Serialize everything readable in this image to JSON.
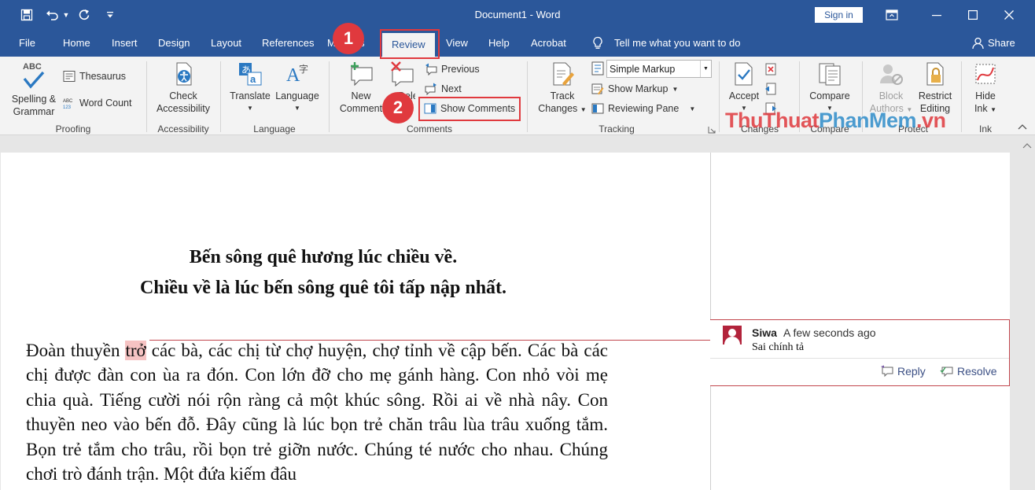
{
  "window": {
    "title": "Document1  -  Word",
    "sign_in": "Sign in",
    "quick_access": [
      "save-icon",
      "undo-icon",
      "redo-icon",
      "customize-icon"
    ],
    "controls": [
      "ribbon-display-icon",
      "minimize-icon",
      "maximize-icon",
      "close-icon"
    ]
  },
  "tabs": {
    "file": "File",
    "home": "Home",
    "insert": "Insert",
    "design": "Design",
    "layout": "Layout",
    "references": "References",
    "mailings": "Mailings",
    "review": "Review",
    "view": "View",
    "help": "Help",
    "acrobat": "Acrobat",
    "tell_me": "Tell me what you want to do",
    "share": "Share"
  },
  "ribbon": {
    "proofing": {
      "label": "Proofing",
      "spelling_line1": "Spelling &",
      "spelling_line2": "Grammar",
      "abc_caption": "ABC",
      "thesaurus": "Thesaurus",
      "word_count": "Word Count"
    },
    "accessibility": {
      "label": "Accessibility",
      "check_line1": "Check",
      "check_line2": "Accessibility"
    },
    "language": {
      "label": "Language",
      "translate": "Translate",
      "language": "Language"
    },
    "comments": {
      "label": "Comments",
      "new_line1": "New",
      "new_line2": "Comment",
      "delete": "Delete",
      "previous": "Previous",
      "next": "Next",
      "show_comments": "Show Comments"
    },
    "tracking": {
      "label": "Tracking",
      "track_line1": "Track",
      "track_line2": "Changes",
      "markup_select": "Simple Markup",
      "show_markup": "Show Markup",
      "reviewing_pane": "Reviewing Pane"
    },
    "changes": {
      "label": "Changes",
      "accept": "Accept"
    },
    "compare": {
      "label": "Compare",
      "compare": "Compare"
    },
    "protect": {
      "label": "Protect",
      "block_line1": "Block",
      "block_line2": "Authors",
      "restrict_line1": "Restrict",
      "restrict_line2": "Editing"
    },
    "ink": {
      "label": "Ink",
      "hide_line1": "Hide",
      "hide_line2": "Ink"
    }
  },
  "annotations": {
    "step1": "1",
    "step2": "2"
  },
  "watermark": {
    "part1": "ThuThuat",
    "part2": "PhanMem",
    "part3": ".vn"
  },
  "document": {
    "title_line1": "Bến sông quê hương lúc chiều về.",
    "title_line2": "Chiều về là lúc bến sông quê tôi tấp nập nhất.",
    "para_before": "Đoàn thuyền ",
    "para_marked": "trở",
    "para_after": " các bà, các chị từ chợ huyện, chợ tỉnh về cập bến. Các bà các chị được đàn con ùa ra đón. Con lớn đỡ cho mẹ gánh hàng. Con nhỏ vòi mẹ chia quà. Tiếng cười nói rộn ràng cả một khúc sông. Rồi ai về nhà nây. Con thuyền neo vào bến đỗ. Đây cũng là lúc bọn trẻ chăn trâu lùa trâu xuống tắm. Bọn trẻ tắm cho trâu, rồi bọn trẻ giỡn nước. Chúng té nước cho nhau. Chúng chơi trò đánh trận. Một đứa kiếm đâu"
  },
  "comment": {
    "author": "Siwa",
    "time": "A few seconds ago",
    "text": "Sai chính tả",
    "reply": "Reply",
    "resolve": "Resolve"
  },
  "colors": {
    "word_blue": "#2b579a",
    "highlight_red": "#e0393e",
    "comment_line": "#c2464d"
  }
}
